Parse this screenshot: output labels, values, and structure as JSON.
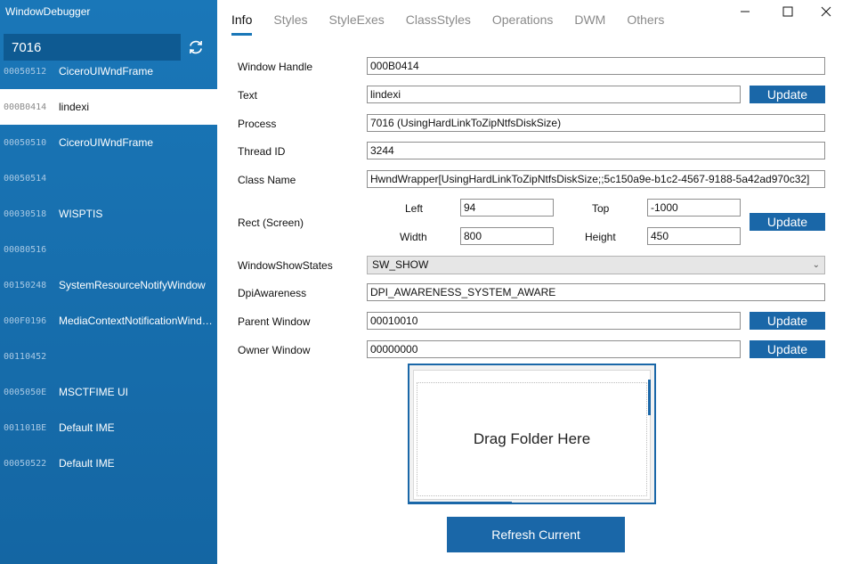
{
  "app": {
    "title": "WindowDebugger"
  },
  "search": {
    "value": "7016"
  },
  "icons": {
    "refresh": "refresh-icon",
    "minimize": "minimize-icon",
    "maximize": "maximize-icon",
    "close": "close-icon",
    "dropdown": "chevron-down-icon"
  },
  "colors": {
    "sidebar": "#1a77b8",
    "accent": "#1a67a8",
    "selected": "#ffffff"
  },
  "windows": [
    {
      "handle": "00050512",
      "name": "CiceroUIWndFrame"
    },
    {
      "handle": "000B0414",
      "name": "lindexi"
    },
    {
      "handle": "00050510",
      "name": "CiceroUIWndFrame"
    },
    {
      "handle": "00050514",
      "name": ""
    },
    {
      "handle": "00030518",
      "name": "WISPTIS"
    },
    {
      "handle": "00080516",
      "name": ""
    },
    {
      "handle": "00150248",
      "name": "SystemResourceNotifyWindow"
    },
    {
      "handle": "000F0196",
      "name": "MediaContextNotificationWindow"
    },
    {
      "handle": "00110452",
      "name": ""
    },
    {
      "handle": "0005050E",
      "name": "MSCTFIME UI"
    },
    {
      "handle": "001101BE",
      "name": "Default IME"
    },
    {
      "handle": "00050522",
      "name": "Default IME"
    }
  ],
  "selected_window": "000B0414",
  "tabs": [
    "Info",
    "Styles",
    "StyleExes",
    "ClassStyles",
    "Operations",
    "DWM",
    "Others"
  ],
  "active_tab": "Info",
  "info": {
    "window_handle_label": "Window Handle",
    "window_handle": "000B0414",
    "text_label": "Text",
    "text": "lindexi",
    "process_label": "Process",
    "process": "7016 (UsingHardLinkToZipNtfsDiskSize)",
    "thread_label": "Thread ID",
    "thread": "3244",
    "class_label": "Class Name",
    "class_name": "HwndWrapper[UsingHardLinkToZipNtfsDiskSize;;5c150a9e-b1c2-4567-9188-5a42ad970c32]",
    "rect_label": "Rect (Screen)",
    "left_label": "Left",
    "left": "94",
    "top_label": "Top",
    "top": "-1000",
    "width_label": "Width",
    "width": "800",
    "height_label": "Height",
    "height": "450",
    "show_states_label": "WindowShowStates",
    "show_state": "SW_SHOW",
    "dpi_label": "DpiAwareness",
    "dpi": "DPI_AWARENESS_SYSTEM_AWARE",
    "parent_label": "Parent Window",
    "parent": "00010010",
    "owner_label": "Owner Window",
    "owner": "00000000",
    "update_label": "Update"
  },
  "preview": {
    "drop_text": "Drag Folder Here"
  },
  "refresh_button": "Refresh Current"
}
